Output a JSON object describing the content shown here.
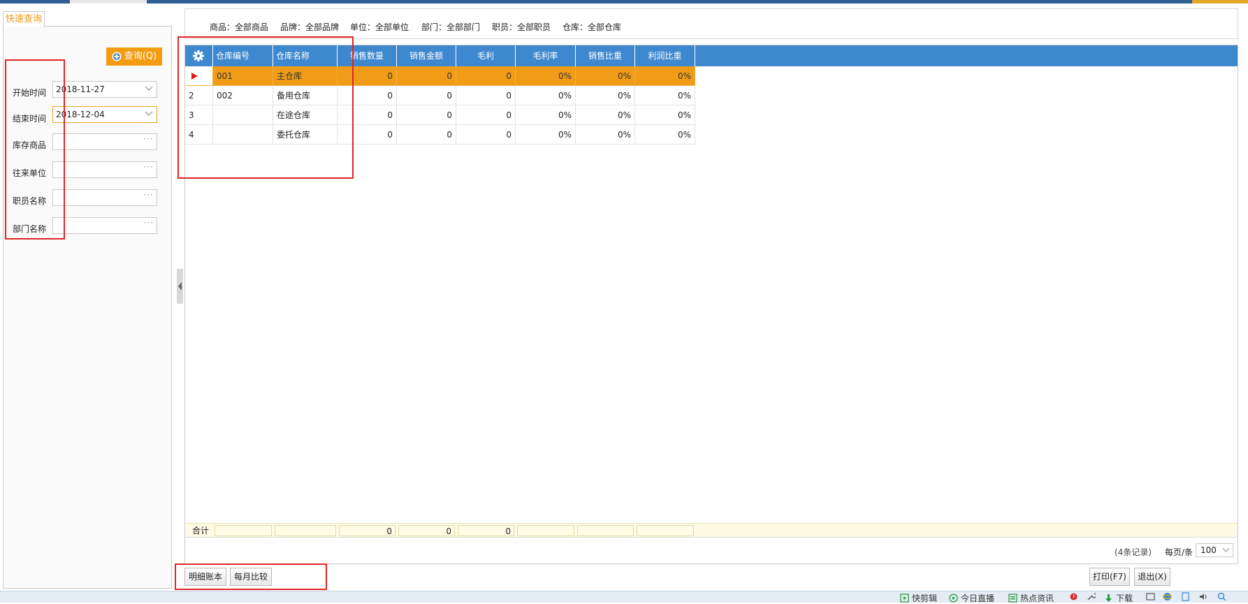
{
  "left_panel": {
    "tab_label": "快速查询",
    "query_button": "查询(Q)",
    "fields": [
      {
        "label": "开始时间",
        "value": "2018-11-27",
        "kind": "date"
      },
      {
        "label": "结束时间",
        "value": "2018-12-04",
        "kind": "date"
      },
      {
        "label": "库存商品",
        "value": "",
        "kind": "picker"
      },
      {
        "label": "往来单位",
        "value": "",
        "kind": "picker"
      },
      {
        "label": "职员名称",
        "value": "",
        "kind": "picker"
      },
      {
        "label": "部门名称",
        "value": "",
        "kind": "picker"
      }
    ]
  },
  "filter_bar": [
    "商品：全部商品",
    "品牌：全部品牌",
    "单位：全部单位",
    "部门：全部部门",
    "职员：全部职员",
    "仓库：全部仓库"
  ],
  "grid": {
    "settings_icon": "gear-icon",
    "columns": [
      "仓库编号",
      "仓库名称",
      "销售数量",
      "销售金额",
      "毛利",
      "毛利率",
      "销售比重",
      "利润比重"
    ],
    "rows": [
      {
        "index": "",
        "selected": true,
        "cells": [
          "001",
          "主仓库",
          "0",
          "0",
          "0",
          "0%",
          "0%",
          "0%"
        ]
      },
      {
        "index": "2",
        "selected": false,
        "cells": [
          "002",
          "备用仓库",
          "0",
          "0",
          "0",
          "0%",
          "0%",
          "0%"
        ]
      },
      {
        "index": "3",
        "selected": false,
        "cells": [
          "",
          "在途仓库",
          "0",
          "0",
          "0",
          "0%",
          "0%",
          "0%"
        ]
      },
      {
        "index": "4",
        "selected": false,
        "cells": [
          "",
          "委托仓库",
          "0",
          "0",
          "0",
          "0%",
          "0%",
          "0%"
        ]
      }
    ],
    "summary": {
      "label": "合计",
      "cells": [
        "",
        "",
        "0",
        "0",
        "0",
        "",
        "",
        ""
      ]
    },
    "selection_color": "#f09c16",
    "header_color": "#3e88cf"
  },
  "pager": {
    "record_count": "(4条记录)",
    "per_page_label": "每页/条",
    "per_page_value": "100"
  },
  "buttons": {
    "detail_ledger": "明细账本",
    "monthly_compare": "每月比较",
    "print": "打印(F7)",
    "exit": "退出(X)"
  },
  "status_bar": [
    {
      "icon": "video-icon",
      "label": "快剪辑"
    },
    {
      "icon": "play-icon",
      "label": "今日直播"
    },
    {
      "icon": "news-icon",
      "label": "热点资讯"
    },
    {
      "icon": "download-icon",
      "label": "下载"
    }
  ],
  "accent": "#f39c12"
}
